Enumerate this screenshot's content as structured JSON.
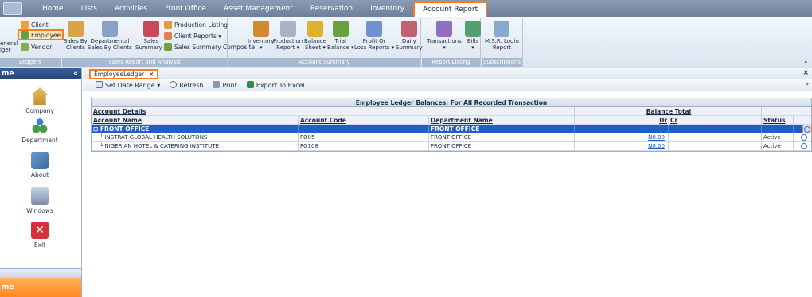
{
  "menu": {
    "tabs": [
      "Home",
      "Lists",
      "Activities",
      "Front Office",
      "Asset Management",
      "Reservation",
      "Inventory",
      "Account Report"
    ],
    "active_tab": "Account Report"
  },
  "ribbon": {
    "ledgers": {
      "items": [
        "Client",
        "Employee",
        "Vendor"
      ],
      "general_ledger": "eneral\nlger",
      "label": "Ledgers"
    },
    "sales": {
      "sales_by_clients": "Sales By\nClients",
      "departmental": "Departmental\nSales By Clients",
      "sales_summary": "Sales\nSummary ▾",
      "production_listing": "Production Listing",
      "client_reports": "Client Reports ▾",
      "sales_summary_composite": "Sales Summary Composite",
      "label": "Sales Report and Analysis"
    },
    "account": {
      "inventory": "Inventory\n▾",
      "production_report": "Production\nReport ▾",
      "balance_sheet": "Balance\nSheet ▾",
      "trial_balance": "Trial\nBalance ▾",
      "profit_loss": "Profit Or\nLoss Reports ▾",
      "daily_summary": "Daily\nSummary",
      "label": "Account Summary"
    },
    "report_listing": {
      "transactions": "Transactions\n▾",
      "bills": "Bills\n▾",
      "label": "Report Listing"
    },
    "subscriptions": {
      "msr": "M.S.R. Login\nReport",
      "label": "Subscriptions"
    }
  },
  "sidebar": {
    "title": "me",
    "footer": "me",
    "items": [
      "Company",
      "Department",
      "About",
      "Windows",
      "Exit"
    ]
  },
  "document_tab": {
    "label": "EmployeeLedger",
    "close": "×"
  },
  "toolbar": {
    "set_date_range": "Set Date Range ▾",
    "refresh": "Refresh",
    "print": "Print",
    "export": "Export To Excel"
  },
  "grid": {
    "title": "Employee Ledger Balances: For All Recorded Transaction",
    "group_headers": {
      "account_details": "Account Details",
      "balance_total": "Balance Total"
    },
    "columns": {
      "account_name": "Account Name",
      "account_code": "Account Code",
      "department_name": "Department Name",
      "dr": "Dr",
      "cr": "Cr",
      "status": "Status"
    },
    "group_row": {
      "toggle": "⊟",
      "name": "FRONT OFFICE",
      "department": "FRONT OFFICE"
    },
    "rows": [
      {
        "name": "INSTRAT GLOBAL HEALTH SOLUTONS",
        "code": "FO05",
        "department": "FRONT OFFICE",
        "dr": "N0.00",
        "cr": "",
        "status": "Active"
      },
      {
        "name": "NIGERIAN HOTEL & CATERING INSTITUTE",
        "code": "FO108",
        "department": "FRONT OFFICE",
        "dr": "N0.00",
        "cr": "",
        "status": "Active"
      }
    ]
  },
  "colors": {
    "accent": "#ff7a1a",
    "selection": "#1f5fc7",
    "sidebar_head": "#2a4d85"
  }
}
